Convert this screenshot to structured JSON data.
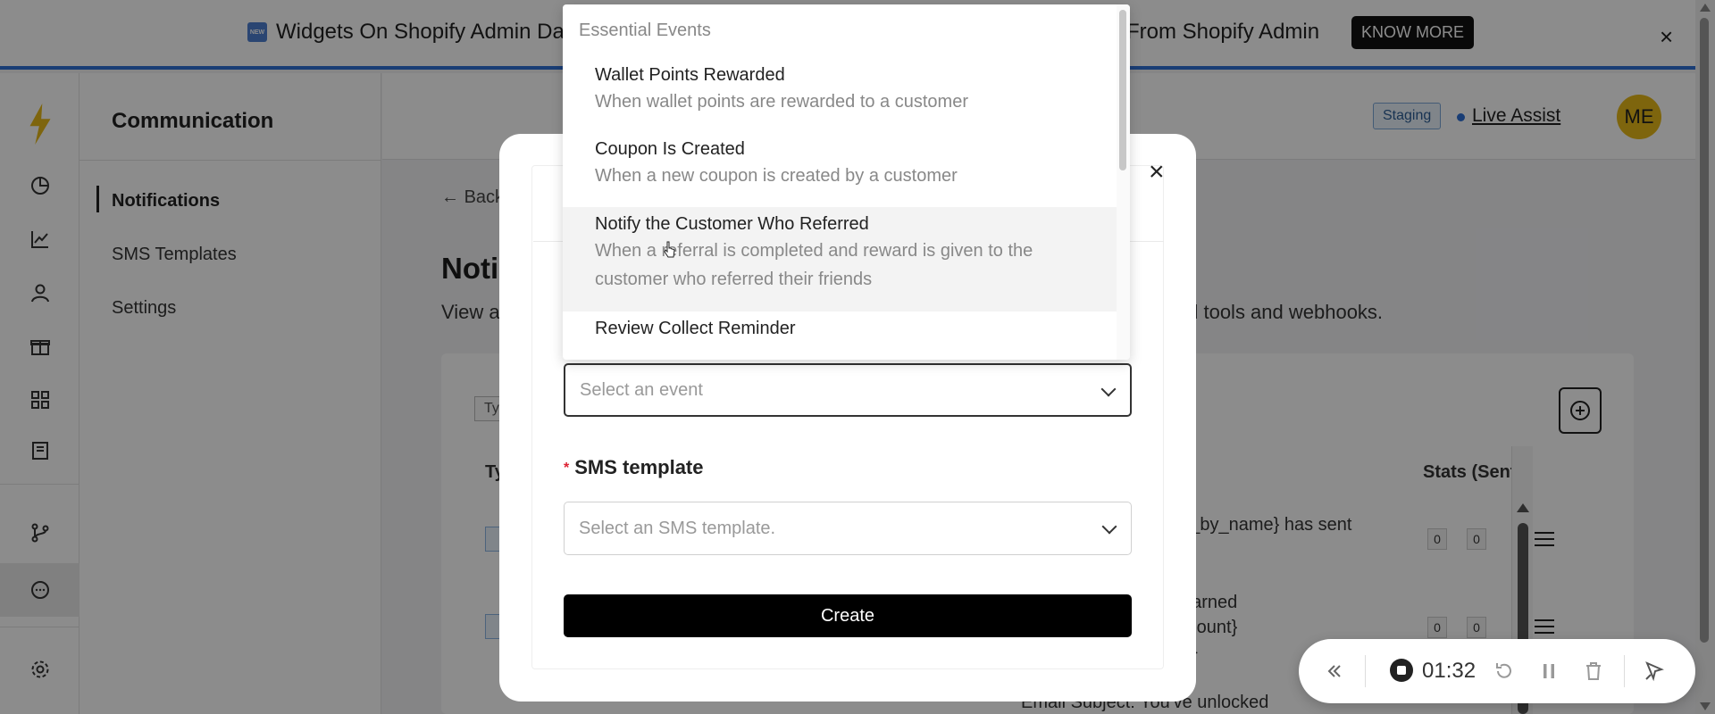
{
  "banner": {
    "text_left": "Widgets On Shopify Admin Das",
    "text_right": "From Shopify Admin",
    "new_label": "NEW",
    "cta": "KNOW MORE",
    "close": "×"
  },
  "header": {
    "staging": "Staging",
    "live_assist": "Live Assist",
    "avatar_initials": "ME"
  },
  "sidebar": {
    "title": "Communication",
    "items": [
      {
        "label": "Notifications"
      },
      {
        "label": "SMS Templates"
      },
      {
        "label": "Settings"
      }
    ]
  },
  "main": {
    "back": "Back",
    "title": "Noti",
    "desc_left": "View a",
    "desc_right": "nal tools and webhooks.",
    "type_chip": "Ty",
    "th_type": "Ty",
    "th_stats": "Stats (Sent,",
    "rows": [
      {
        "text": "ed_by_name} has sent",
        "stats": [
          "0",
          "0"
        ]
      },
      {
        "text_lines": [
          "earned",
          "mount}",
          "e}"
        ],
        "stats": [
          "0",
          "0"
        ]
      },
      {
        "text": "Email Subject: You've unlocked"
      }
    ]
  },
  "modal": {
    "event_placeholder": "Select an event",
    "sms_label": "SMS template",
    "sms_required_mark": "*",
    "sms_placeholder": "Select an SMS template.",
    "create": "Create",
    "close": "×"
  },
  "dropdown": {
    "group": "Essential Events",
    "items": [
      {
        "title": "Wallet Points Rewarded",
        "desc": "When wallet points are rewarded to a customer"
      },
      {
        "title": "Coupon Is Created",
        "desc": "When a new coupon is created by a customer"
      },
      {
        "title": "Notify the Customer Who Referred",
        "desc": "When a referral is completed and reward is given to the customer who referred their friends"
      },
      {
        "title": "Review Collect Reminder",
        "desc": ""
      }
    ]
  },
  "recorder": {
    "time": "01:32"
  },
  "colors": {
    "accent_blue": "#2f6fd6",
    "avatar_yellow": "#e6b819",
    "logo_yellow": "#e6b819"
  },
  "icons": [
    "bolt-logo-icon",
    "analytics-icon",
    "chart-icon",
    "user-icon",
    "gift-icon",
    "widgets-icon",
    "book-icon",
    "branch-icon",
    "chat-icon",
    "gear-icon",
    "add-icon",
    "menu-icon",
    "rewind-icon",
    "stop-icon",
    "restart-icon",
    "pause-icon",
    "trash-icon",
    "pointer-icon"
  ]
}
